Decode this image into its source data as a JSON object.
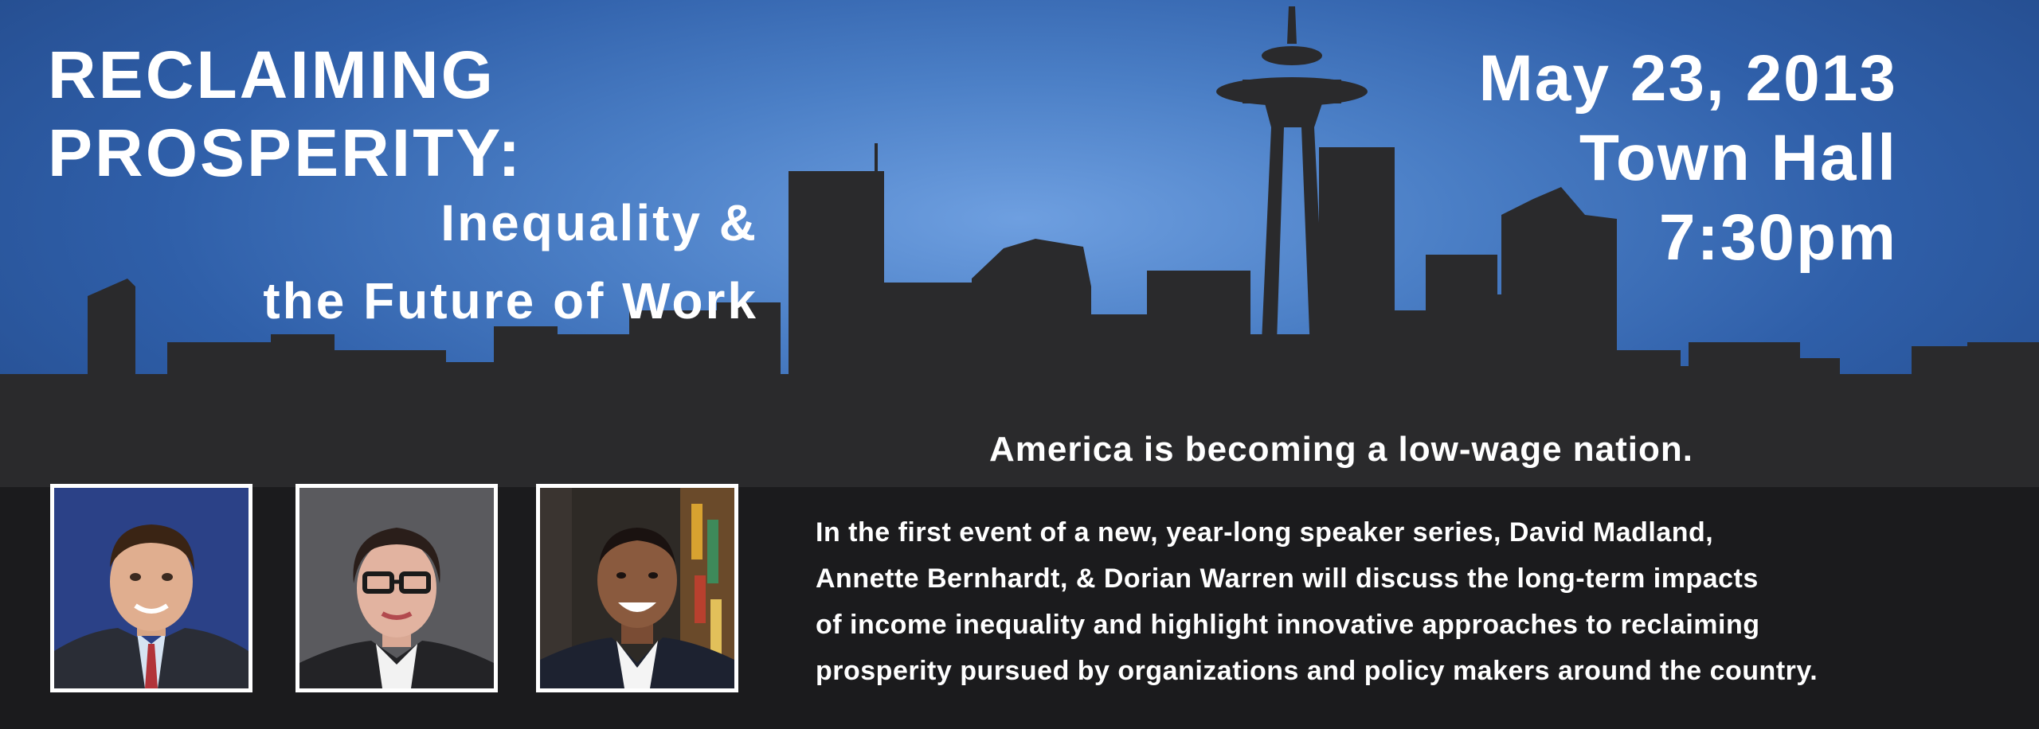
{
  "banner": {
    "title_line1": "RECLAIMING",
    "title_line2": "PROSPERITY:",
    "subtitle_line1": "Inequality &",
    "subtitle_line2": "the Future of Work",
    "date": "May 23, 2013",
    "venue": "Town Hall",
    "time": "7:30pm",
    "tagline": "America is becoming a low-wage nation.",
    "description_lines": [
      "In the first event of a new, year-long speaker series, David Madland,",
      "Annette Bernhardt, & Dorian Warren will discuss the long-term impacts",
      "of income inequality and highlight innovative approaches to reclaiming",
      "prosperity pursued by organizations and policy makers around the country."
    ]
  },
  "colors": {
    "sky_blue": "#4b7fc6",
    "skyline": "#2a2a2c",
    "band": "#1b1b1d",
    "text": "#ffffff"
  },
  "speakers": [
    {
      "photo": "speaker-photo-1"
    },
    {
      "photo": "speaker-photo-2"
    },
    {
      "photo": "speaker-photo-3"
    }
  ]
}
